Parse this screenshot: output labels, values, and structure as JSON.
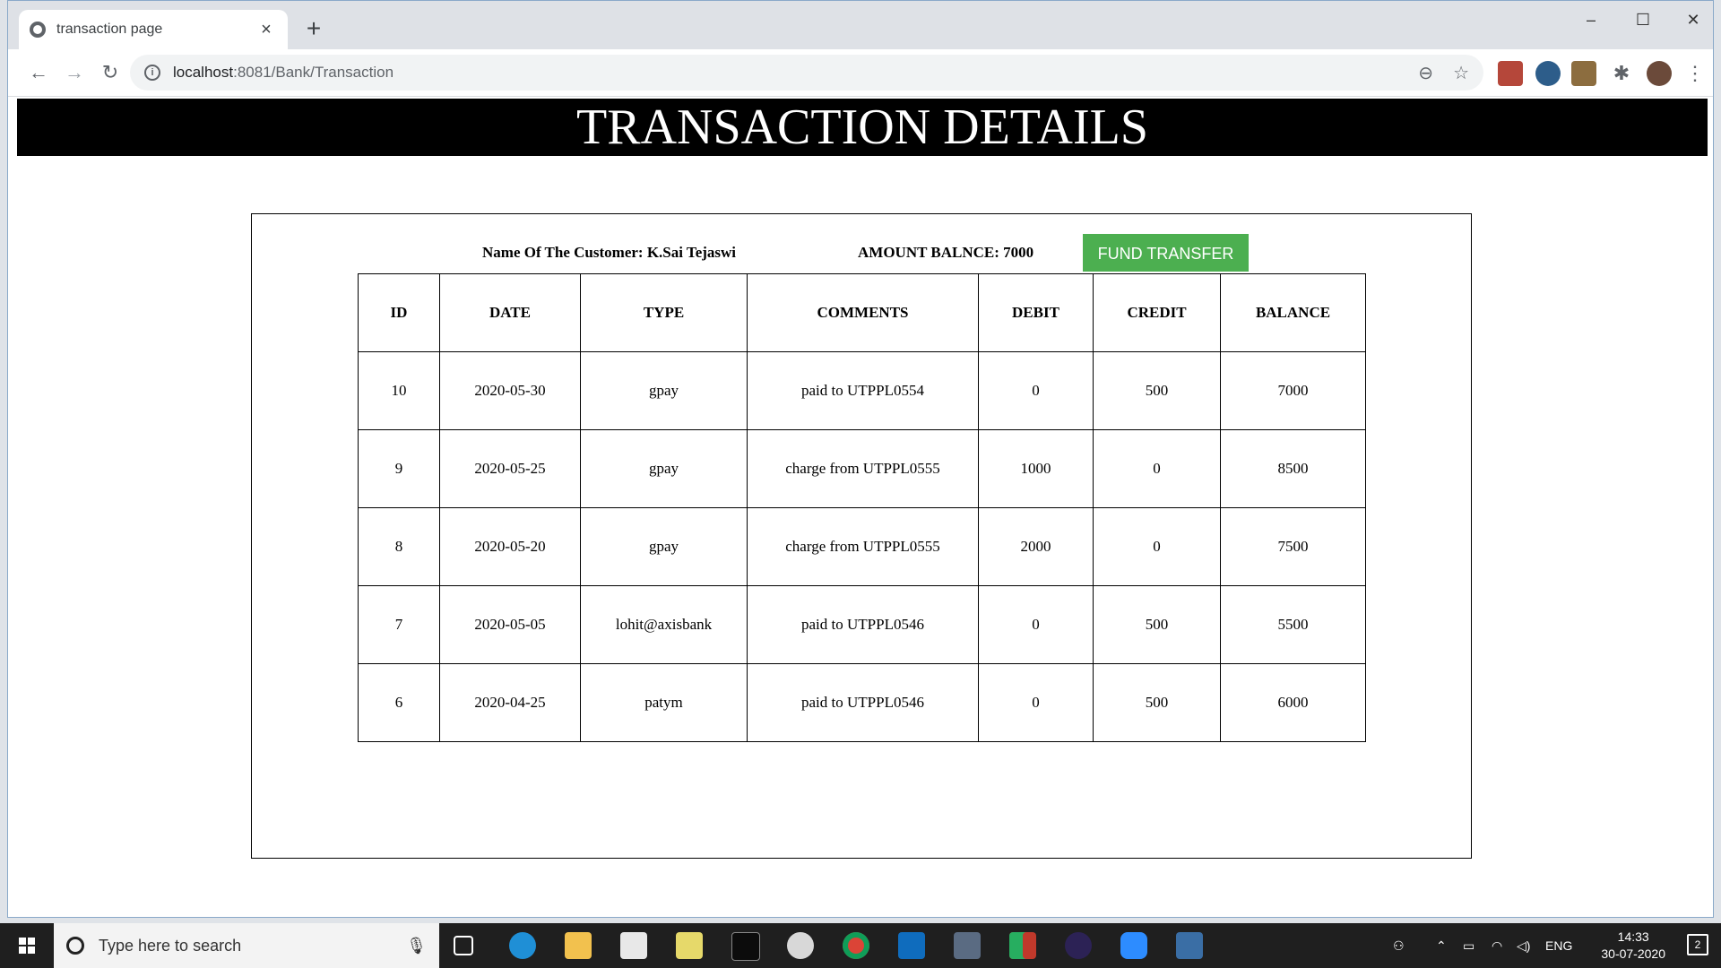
{
  "browser": {
    "tab_title": "transaction page",
    "tab_close": "×",
    "new_tab": "+",
    "url_host": "localhost",
    "url_rest": ":8081/Bank/Transaction",
    "window_controls": {
      "minimize": "–",
      "maximize": "☐",
      "close": "✕"
    }
  },
  "page": {
    "heading": "TRANSACTION DETAILS",
    "customer_label": "Name Of The Customer: K.Sai Tejaswi",
    "balance_label": "AMOUNT BALNCE: 7000",
    "fund_transfer_button": "FUND TRANSFER",
    "table": {
      "headers": [
        "ID",
        "DATE",
        "TYPE",
        "COMMENTS",
        "DEBIT",
        "CREDIT",
        "BALANCE"
      ],
      "rows": [
        [
          "10",
          "2020-05-30",
          "gpay",
          "paid to UTPPL0554",
          "0",
          "500",
          "7000"
        ],
        [
          "9",
          "2020-05-25",
          "gpay",
          "charge from UTPPL0555",
          "1000",
          "0",
          "8500"
        ],
        [
          "8",
          "2020-05-20",
          "gpay",
          "charge from UTPPL0555",
          "2000",
          "0",
          "7500"
        ],
        [
          "7",
          "2020-05-05",
          "lohit@axisbank",
          "paid to UTPPL0546",
          "0",
          "500",
          "5500"
        ],
        [
          "6",
          "2020-04-25",
          "patym",
          "paid to UTPPL0546",
          "0",
          "500",
          "6000"
        ]
      ]
    }
  },
  "taskbar": {
    "search_placeholder": "Type here to search",
    "language": "ENG",
    "time": "14:33",
    "date": "30-07-2020",
    "notification_count": "2"
  },
  "colors": {
    "banner_bg": "#000000",
    "fund_button_bg": "#4caf50",
    "taskbar_bg": "#1f1f1f"
  }
}
